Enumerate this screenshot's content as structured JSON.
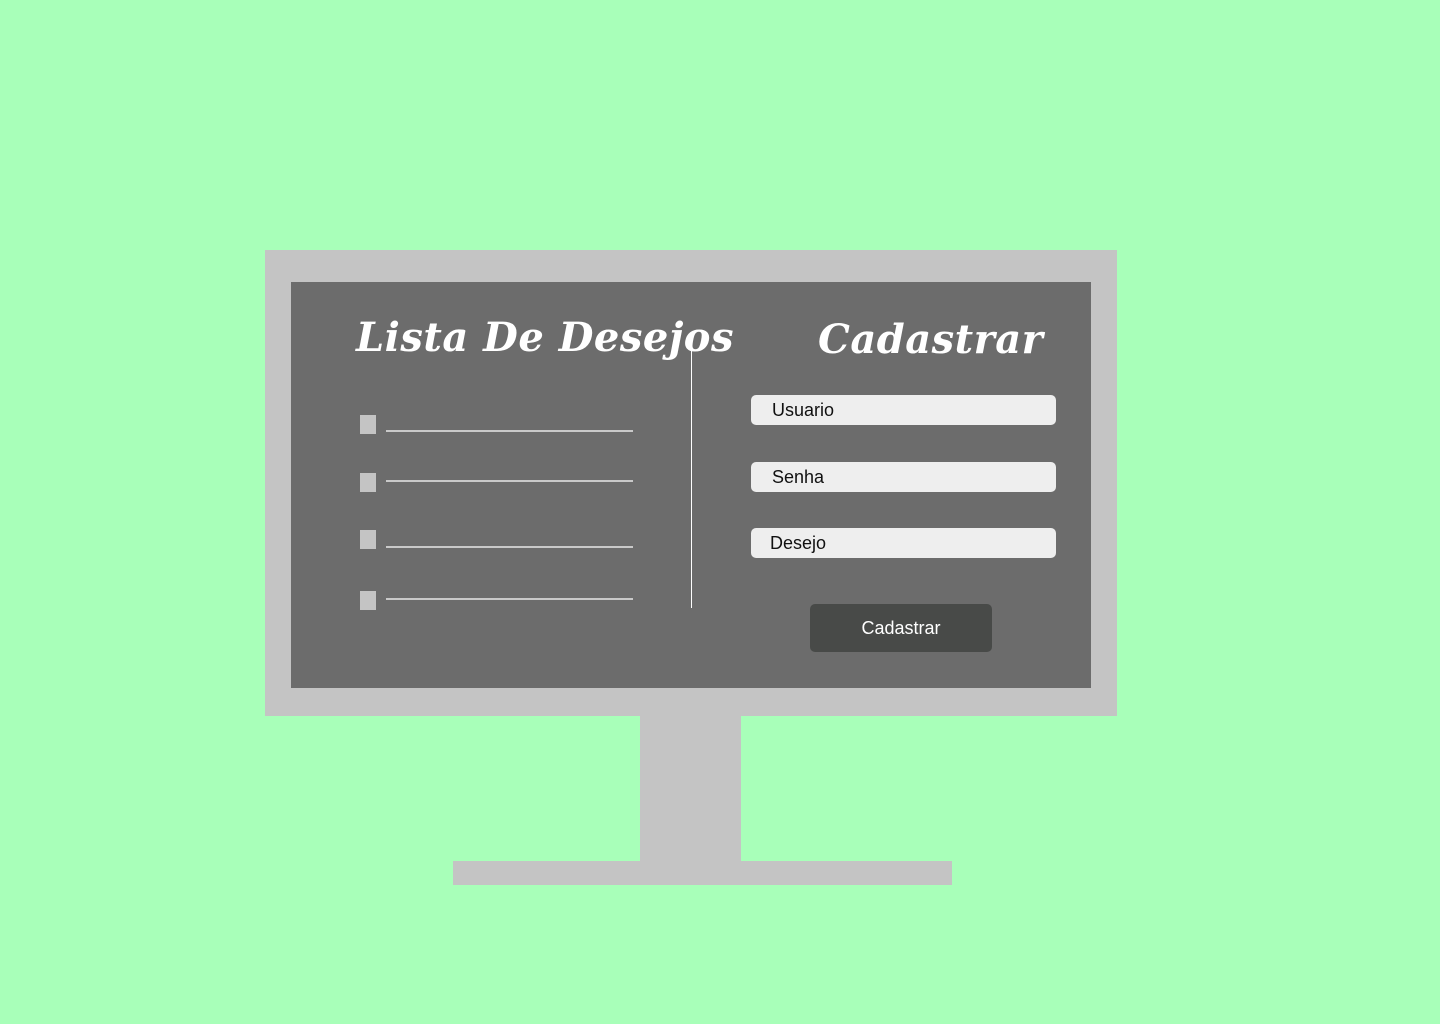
{
  "colors": {
    "background": "#a8ffb9",
    "monitor": "#c4c4c4",
    "screen": "#6c6c6c",
    "field": "#eeeeee",
    "button": "#484a48"
  },
  "wishlist": {
    "title": "Lista De Desejos",
    "items": [
      "",
      "",
      "",
      ""
    ]
  },
  "signup": {
    "title": "Cadastrar",
    "user_label": "Usuario",
    "password_label": "Senha",
    "wish_label": "Desejo",
    "submit_label": "Cadastrar"
  }
}
